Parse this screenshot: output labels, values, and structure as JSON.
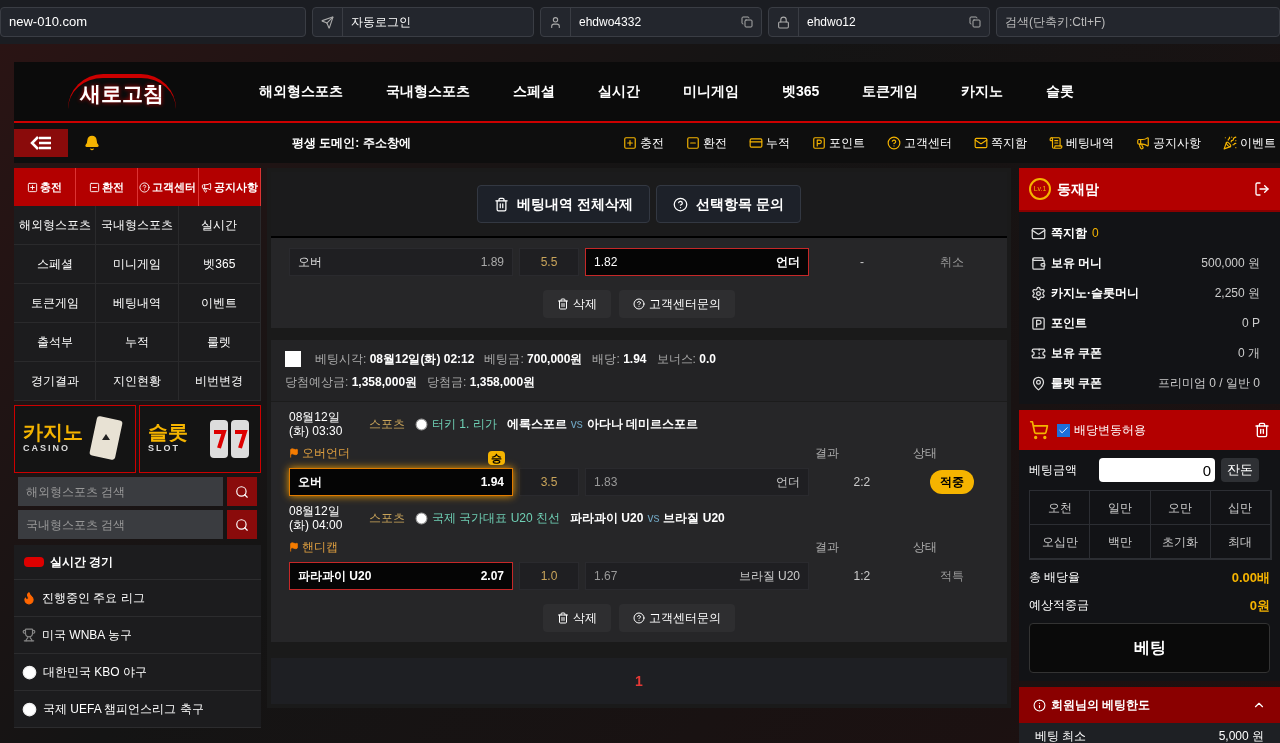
{
  "browser_bar": {
    "address": "new-010.com",
    "fields": [
      {
        "kind": "send",
        "value": "자동로그인"
      },
      {
        "kind": "user",
        "value": "ehdwo4332"
      },
      {
        "kind": "lock",
        "value": "ehdwo12"
      }
    ],
    "search_placeholder": "검색(단축키:Ctl+F)"
  },
  "logo": "새로고침",
  "nav": [
    "해외형스포츠",
    "국내형스포츠",
    "스페셜",
    "실시간",
    "미니게임",
    "벳365",
    "토큰게임",
    "카지노",
    "슬롯"
  ],
  "subbar": {
    "notice": "평생 도메인: 주소창에",
    "links": [
      {
        "kind": "plus",
        "label": "충전"
      },
      {
        "kind": "minus",
        "label": "환전"
      },
      {
        "kind": "card",
        "label": "누적"
      },
      {
        "kind": "point",
        "label": "포인트"
      },
      {
        "kind": "help",
        "label": "고객센터"
      },
      {
        "kind": "mail",
        "label": "쪽지함"
      },
      {
        "kind": "list",
        "label": "베팅내역"
      },
      {
        "kind": "megaphone",
        "label": "공지사항"
      },
      {
        "kind": "party",
        "label": "이벤트"
      }
    ]
  },
  "left": {
    "quick": [
      {
        "kind": "plus",
        "label": "충전"
      },
      {
        "kind": "minus",
        "label": "환전"
      },
      {
        "kind": "help",
        "label": "고객센터"
      },
      {
        "kind": "megaphone",
        "label": "공지사항"
      }
    ],
    "menu": [
      "해외형스포츠",
      "국내형스포츠",
      "실시간",
      "스페셜",
      "미니게임",
      "벳365",
      "토큰게임",
      "베팅내역",
      "이벤트",
      "출석부",
      "누적",
      "룰렛",
      "경기결과",
      "지인현황",
      "비번변경"
    ],
    "banners": [
      {
        "kind": "casino",
        "title": "카지노",
        "subtitle": "CASINO"
      },
      {
        "kind": "slot",
        "title": "슬롯",
        "subtitle": "SLOT"
      }
    ],
    "searches": [
      {
        "placeholder": "해외형스포츠 검색"
      },
      {
        "placeholder": "국내형스포츠 검색"
      }
    ],
    "live_title": "실시간 경기",
    "leagues": [
      {
        "kind": "fire",
        "label": "진행중인 주요 리그"
      },
      {
        "kind": "trophy",
        "label": "미국 WNBA 농구"
      },
      {
        "kind": "baseball",
        "label": "대한민국 KBO 야구"
      },
      {
        "kind": "soccer",
        "label": "국제 UEFA 챔피언스리그 축구"
      }
    ]
  },
  "center": {
    "actions": [
      {
        "kind": "trash",
        "label": "베팅내역 전체삭제"
      },
      {
        "kind": "help",
        "label": "선택항목 문의"
      }
    ],
    "cards": [
      {
        "matches": [
          {
            "pick": {
              "home": "오버",
              "home_odds": "1.89",
              "line": "5.5",
              "away_odds": "1.82",
              "away": "언더",
              "home_selected": false,
              "away_selected": true
            },
            "result": "-",
            "status": {
              "label": "취소",
              "kind": "plain"
            }
          }
        ],
        "buttons": [
          {
            "kind": "trash",
            "label": "삭제"
          },
          {
            "kind": "help",
            "label": "고객센터문의"
          }
        ]
      },
      {
        "header": {
          "checked": false,
          "lines": [
            [
              {
                "label": "베팅시각:",
                "value": "08월12일(화) 02:12"
              },
              {
                "label": "베팅금:",
                "value": "700,000원"
              },
              {
                "label": "배당:",
                "value": "1.94"
              },
              {
                "label": "보너스:",
                "value": "0.0"
              }
            ],
            [
              {
                "label": "당첨예상금:",
                "value": "1,358,000원"
              },
              {
                "label": "당첨금:",
                "value": "1,358,000원"
              }
            ]
          ]
        },
        "matches": [
          {
            "date": "08월12일",
            "time": "(화) 03:30",
            "sport": "스포츠",
            "league": "터키 1. 리가",
            "home_team": "에록스포르",
            "vs": "vs",
            "away_team": "아다나 데미르스포르",
            "market": "오버언더",
            "result_label": "결과",
            "status_label": "상태",
            "pick": {
              "home": "오버",
              "home_odds": "1.94",
              "line": "3.5",
              "away_odds": "1.83",
              "away": "언더",
              "home_selected": true,
              "away_selected": false,
              "badge": "승"
            },
            "result": "2:2",
            "status": {
              "label": "적중",
              "kind": "won"
            }
          },
          {
            "date": "08월12일",
            "time": "(화) 04:00",
            "sport": "스포츠",
            "league": "국제 국가대표 U20 친선",
            "home_team": "파라과이 U20",
            "vs": "vs",
            "away_team": "브라질 U20",
            "market": "핸디캡",
            "result_label": "결과",
            "status_label": "상태",
            "pick": {
              "home": "파라과이 U20",
              "home_odds": "2.07",
              "line": "1.0",
              "away_odds": "1.67",
              "away": "브라질 U20",
              "home_selected": true,
              "away_selected": false
            },
            "result": "1:2",
            "status": {
              "label": "적특",
              "kind": "plain"
            }
          }
        ],
        "buttons": [
          {
            "kind": "trash",
            "label": "삭제"
          },
          {
            "kind": "help",
            "label": "고객센터문의"
          }
        ]
      }
    ],
    "pagination": [
      {
        "label": "1",
        "selected": true
      }
    ]
  },
  "right": {
    "user": {
      "level": "Lv.1",
      "name": "동재맘"
    },
    "stats": [
      {
        "kind": "mail",
        "label": "쪽지함",
        "value": "0"
      },
      {
        "kind": "wallet",
        "label": "보유 머니",
        "value": "500,000 원"
      },
      {
        "kind": "chip",
        "label": "카지노·슬롯머니",
        "value": "2,250 원"
      },
      {
        "kind": "point",
        "label": "포인트",
        "value": "0 P"
      },
      {
        "kind": "ticket",
        "label": "보유 쿠폰",
        "value": "0 개"
      },
      {
        "kind": "pin",
        "label": "룰렛 쿠폰",
        "value": "프리미엄 0 / 일반 0"
      }
    ],
    "slip": {
      "allow_label": "배당변동허용",
      "allow_checked": true,
      "amount_label": "베팅금액",
      "amount": "0",
      "change_button": "잔돈",
      "chips": [
        "오천",
        "일만",
        "오만",
        "십만",
        "오십만",
        "백만",
        "초기화",
        "최대"
      ],
      "totals": [
        {
          "label": "총 배당율",
          "value": "0.00배"
        },
        {
          "label": "예상적중금",
          "value": "0원"
        }
      ],
      "bet_button": "베팅"
    },
    "limits": {
      "title": "회원님의 베팅한도",
      "expanded": true,
      "rows": [
        {
          "label": "베팅 최소",
          "value": "5,000 원"
        }
      ]
    }
  }
}
